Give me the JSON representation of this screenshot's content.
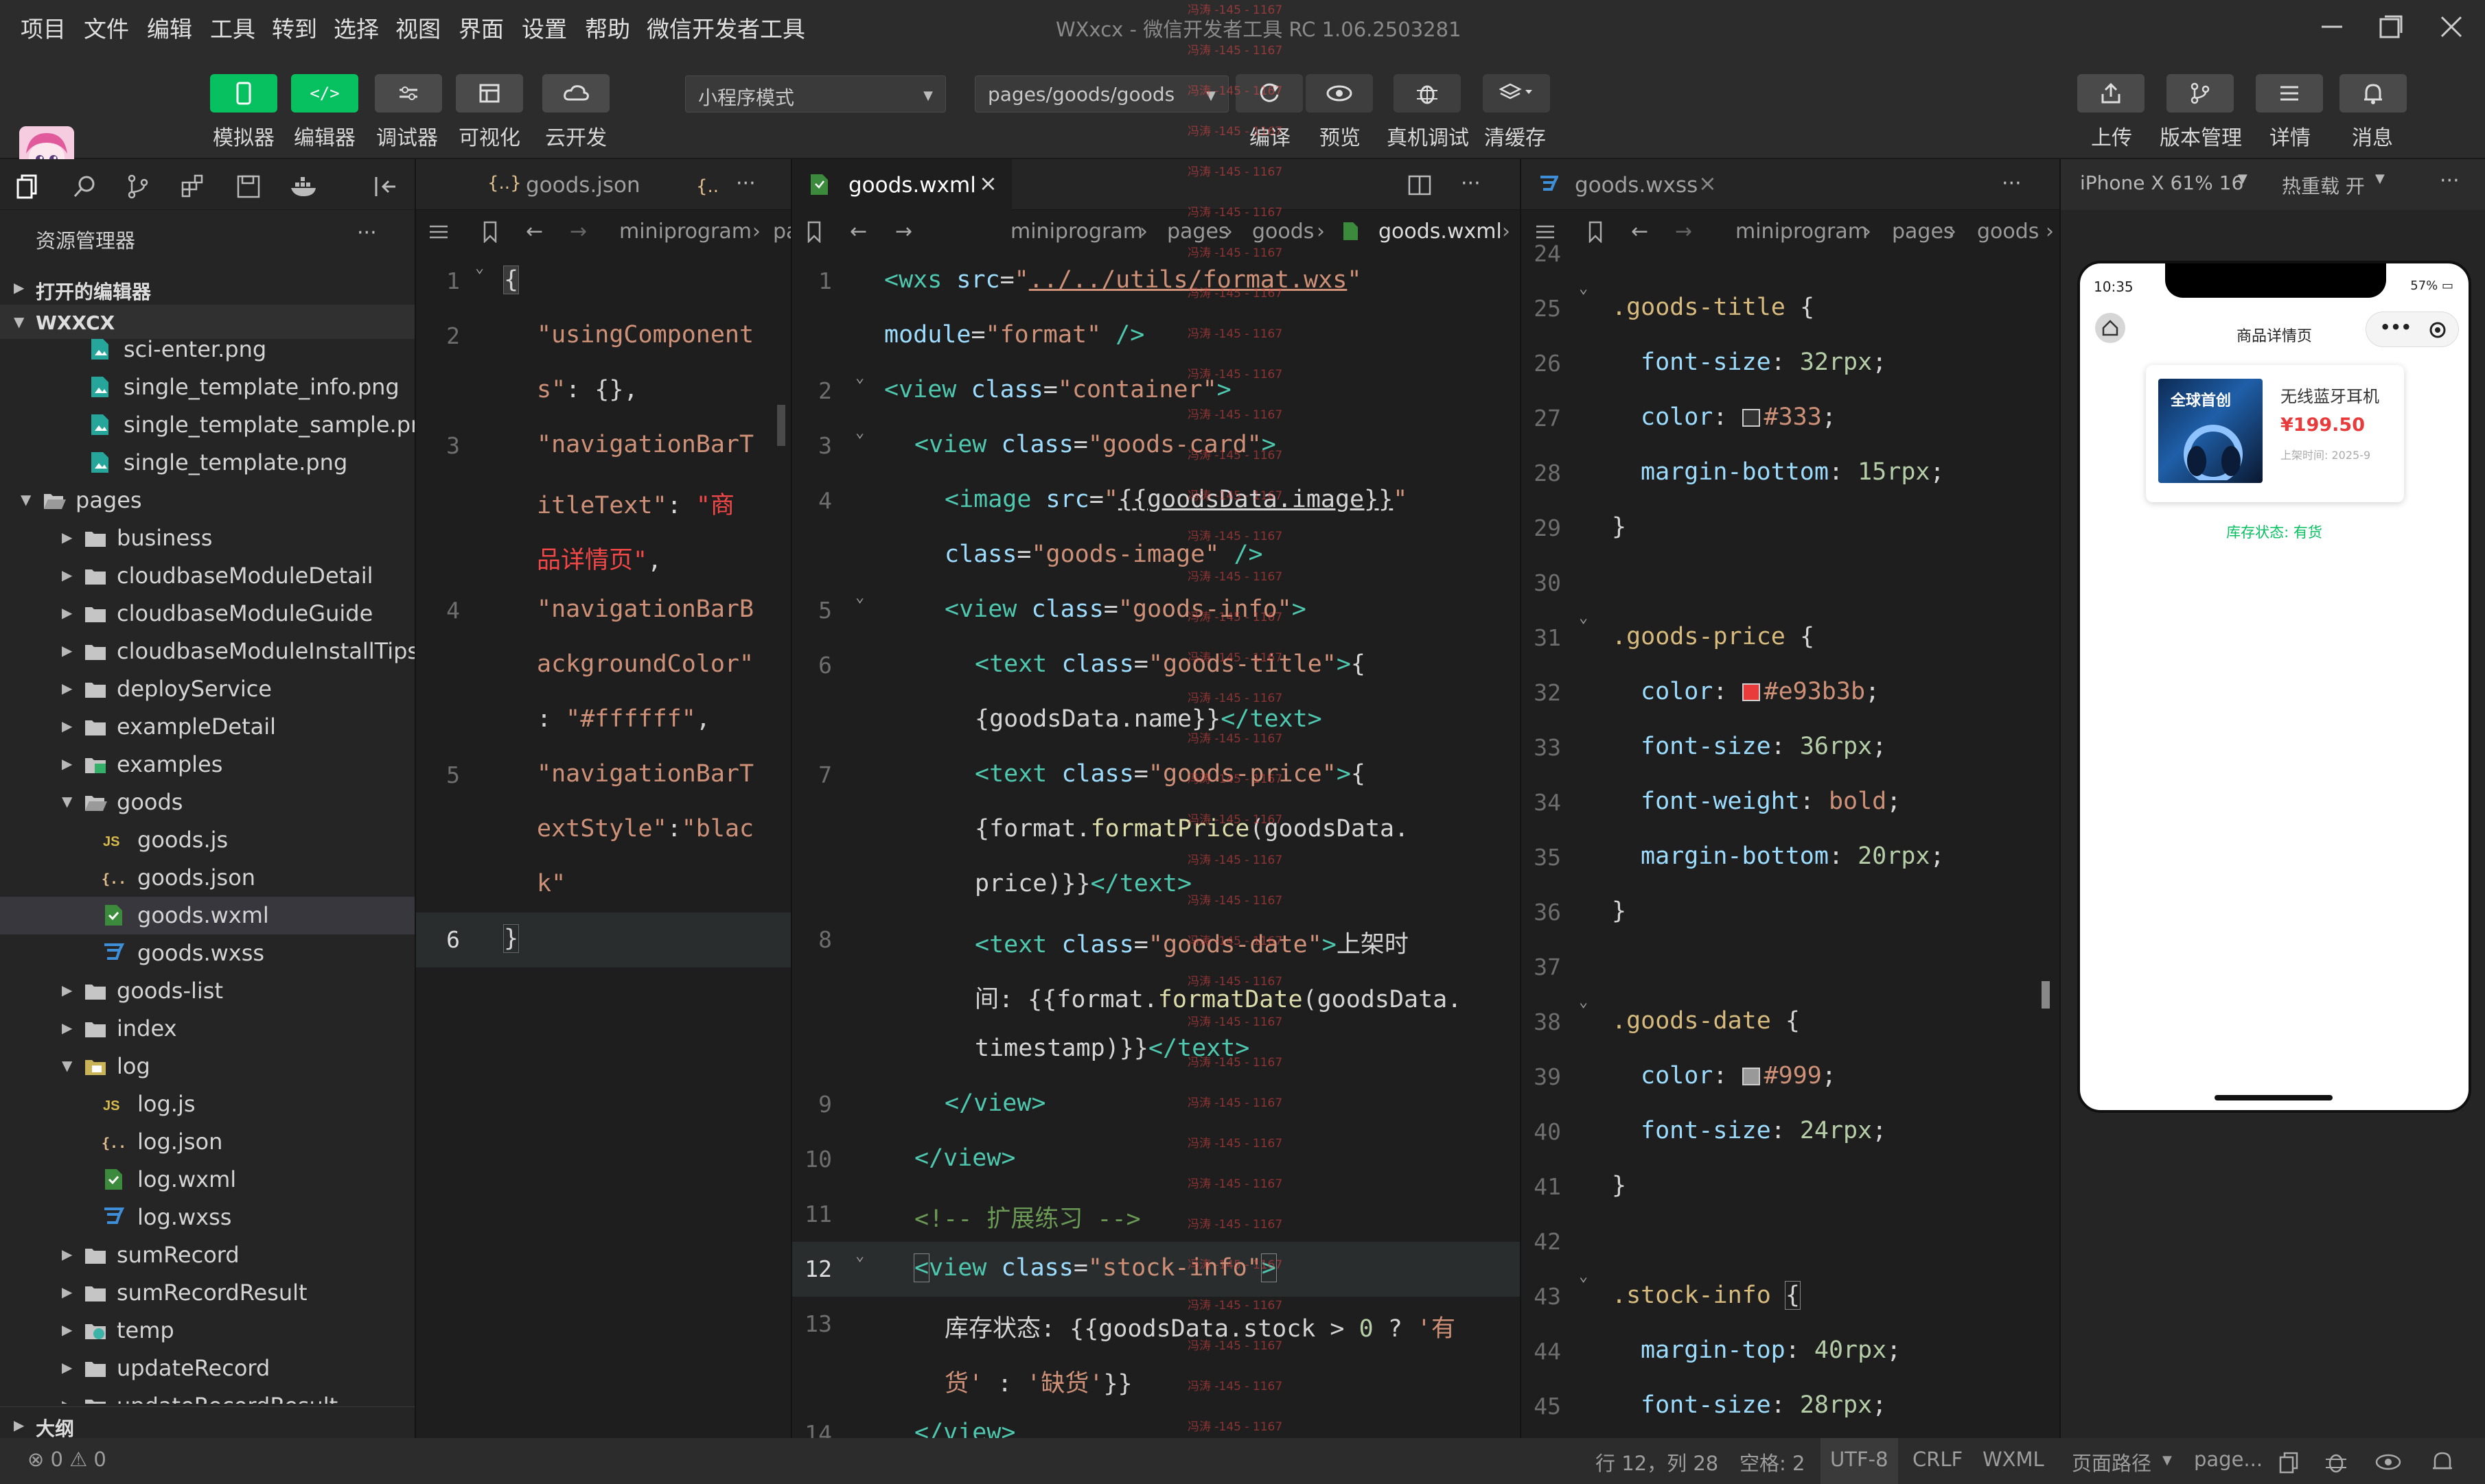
{
  "menu": [
    "项目",
    "文件",
    "编辑",
    "工具",
    "转到",
    "选择",
    "视图",
    "界面",
    "设置",
    "帮助",
    "微信开发者工具"
  ],
  "window_title": "WXxcx - 微信开发者工具 RC 1.06.2503281",
  "toolbar": {
    "simulator_label": "模拟器",
    "editor_label": "编辑器",
    "debugger_label": "调试器",
    "visual_label": "可视化",
    "cloud_label": "云开发",
    "mode_select": "小程序模式",
    "page_select": "pages/goods/goods",
    "compile_label": "编译",
    "preview_label": "预览",
    "remote_debug_label": "真机调试",
    "clear_cache_label": "清缓存",
    "upload_label": "上传",
    "version_label": "版本管理",
    "details_label": "详情",
    "messages_label": "消息"
  },
  "explorer": {
    "title": "资源管理器",
    "open_editors": "打开的编辑器",
    "project": "WXXCX",
    "outline": "大纲",
    "tree": [
      {
        "name": "sci-enter.png",
        "depth": 2,
        "kind": "png"
      },
      {
        "name": "single_template_info.png",
        "depth": 2,
        "kind": "png"
      },
      {
        "name": "single_template_sample.png",
        "depth": 2,
        "kind": "png"
      },
      {
        "name": "single_template.png",
        "depth": 2,
        "kind": "png"
      },
      {
        "name": "pages",
        "depth": 1,
        "kind": "folder-open"
      },
      {
        "name": "business",
        "depth": 2,
        "kind": "folder"
      },
      {
        "name": "cloudbaseModuleDetail",
        "depth": 2,
        "kind": "folder"
      },
      {
        "name": "cloudbaseModuleGuide",
        "depth": 2,
        "kind": "folder"
      },
      {
        "name": "cloudbaseModuleInstallTips",
        "depth": 2,
        "kind": "folder"
      },
      {
        "name": "deployService",
        "depth": 2,
        "kind": "folder"
      },
      {
        "name": "exampleDetail",
        "depth": 2,
        "kind": "folder"
      },
      {
        "name": "examples",
        "depth": 2,
        "kind": "folder-img"
      },
      {
        "name": "goods",
        "depth": 2,
        "kind": "folder-open"
      },
      {
        "name": "goods.js",
        "depth": 3,
        "kind": "js"
      },
      {
        "name": "goods.json",
        "depth": 3,
        "kind": "json"
      },
      {
        "name": "goods.wxml",
        "depth": 3,
        "kind": "wxml",
        "selected": true
      },
      {
        "name": "goods.wxss",
        "depth": 3,
        "kind": "wxss"
      },
      {
        "name": "goods-list",
        "depth": 2,
        "kind": "folder"
      },
      {
        "name": "index",
        "depth": 2,
        "kind": "folder"
      },
      {
        "name": "log",
        "depth": 2,
        "kind": "folder-open-log"
      },
      {
        "name": "log.js",
        "depth": 3,
        "kind": "js"
      },
      {
        "name": "log.json",
        "depth": 3,
        "kind": "json"
      },
      {
        "name": "log.wxml",
        "depth": 3,
        "kind": "wxml"
      },
      {
        "name": "log.wxss",
        "depth": 3,
        "kind": "wxss"
      },
      {
        "name": "sumRecord",
        "depth": 2,
        "kind": "folder"
      },
      {
        "name": "sumRecordResult",
        "depth": 2,
        "kind": "folder"
      },
      {
        "name": "temp",
        "depth": 2,
        "kind": "folder-temp"
      },
      {
        "name": "updateRecord",
        "depth": 2,
        "kind": "folder"
      },
      {
        "name": "updateRecordResult",
        "depth": 2,
        "kind": "folder"
      }
    ]
  },
  "editor_json": {
    "tab": "goods.json",
    "tab2": "{..",
    "crumb": "miniprogram",
    "crumb2": "pa"
  },
  "editor_wxml": {
    "tab": "goods.wxml",
    "crumb": [
      "miniprogram",
      "pages",
      "goods",
      "goods.wxml"
    ]
  },
  "editor_wxss": {
    "tab": "goods.wxss",
    "crumb": [
      "miniprogram",
      "pages",
      "goods"
    ]
  },
  "simulator": {
    "device": "iPhone X 61% 16",
    "hot_reload": "热重载 开",
    "time": "10:35",
    "battery": "57%",
    "nav_title": "商品详情页",
    "product_name": "无线蓝牙耳机",
    "price": "¥199.50",
    "date": "上架时间: 2025-9",
    "stock": "库存状态: 有货",
    "image_text": "全球首创"
  },
  "status": {
    "errors": "0",
    "warnings": "0",
    "position": "行 12，列 28",
    "spaces": "空格: 2",
    "encoding": "UTF-8",
    "eol": "CRLF",
    "language": "WXML",
    "page_path": "页面路径",
    "page_value": "page..."
  },
  "watermark": "冯涛 -145 - 1167",
  "colors": {
    "accent_green": "#07c160",
    "price_red": "#e93b3b"
  }
}
